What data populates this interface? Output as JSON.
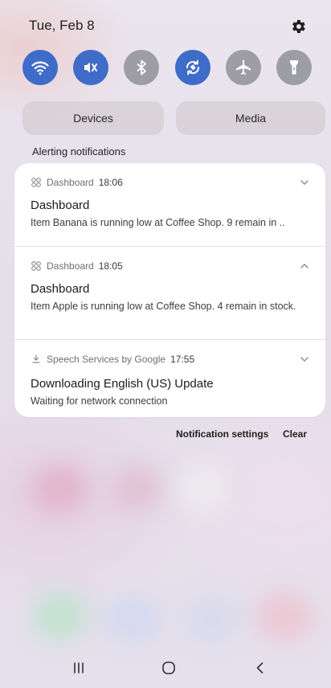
{
  "status": {
    "date": "Tue, Feb 8"
  },
  "quick_settings": [
    {
      "name": "wifi",
      "icon": "wifi-icon",
      "state": "on"
    },
    {
      "name": "mute",
      "icon": "vibrate-mute-icon",
      "state": "on"
    },
    {
      "name": "bluetooth",
      "icon": "bluetooth-icon",
      "state": "off"
    },
    {
      "name": "auto-rotate",
      "icon": "auto-rotate-icon",
      "state": "on"
    },
    {
      "name": "airplane-mode",
      "icon": "airplane-icon",
      "state": "off"
    },
    {
      "name": "flashlight",
      "icon": "flashlight-icon",
      "state": "off"
    }
  ],
  "pills": {
    "devices": "Devices",
    "media": "Media"
  },
  "section_label": "Alerting notifications",
  "notifications": [
    {
      "app": "Dashboard",
      "time": "18:06",
      "title": "Dashboard",
      "body": "Item Banana is running low at Coffee Shop. 9 remain in ..",
      "expanded": false
    },
    {
      "app": "Dashboard",
      "time": "18:05",
      "title": "Dashboard",
      "body": "Item Apple is running low at Coffee Shop. 4 remain in stock.",
      "expanded": true
    },
    {
      "app": "Speech Services by Google",
      "time": "17:55",
      "title": "Downloading English (US) Update",
      "body": "Waiting for network connection",
      "expanded": false
    }
  ],
  "footer": {
    "settings": "Notification settings",
    "clear": "Clear"
  },
  "colors": {
    "toggle_on": "#3f6cc9",
    "toggle_off": "#9d9da5"
  }
}
